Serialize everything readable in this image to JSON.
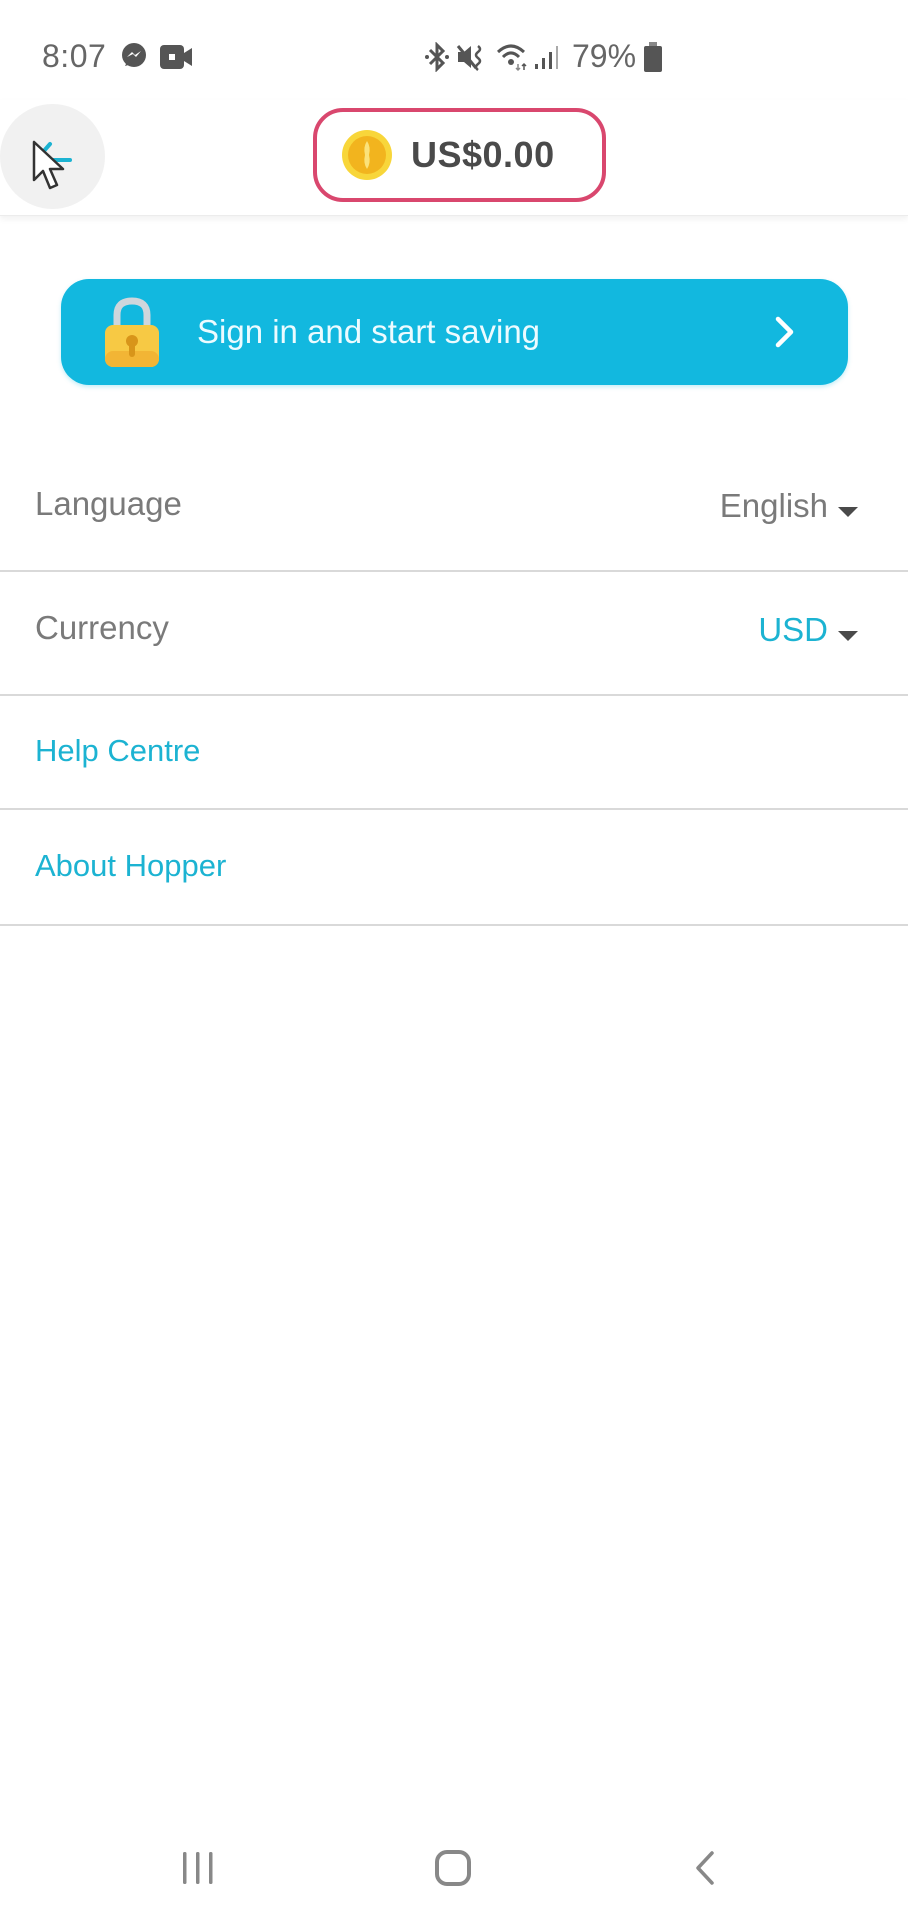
{
  "status_bar": {
    "time": "8:07",
    "left_icons": [
      "messenger-icon",
      "video-camera-icon"
    ],
    "right_icons": [
      "bluetooth-icon",
      "vibrate-mute-icon",
      "wifi-icon",
      "signal-icon",
      "battery-icon"
    ],
    "battery_percent": "79%"
  },
  "header": {
    "back_icon": "arrow-left-icon",
    "balance": "US$0.00",
    "coin_icon": "coin-icon",
    "colors": {
      "pill_border": "#d9476e",
      "accent": "#1cb3d2"
    }
  },
  "signin_banner": {
    "label": "Sign in and start saving",
    "icon": "lock-icon",
    "chevron": "chevron-right-icon",
    "background": "#12b8df"
  },
  "settings": {
    "language": {
      "label": "Language",
      "value": "English"
    },
    "currency": {
      "label": "Currency",
      "value": "USD"
    },
    "links": [
      {
        "label": "Help Centre"
      },
      {
        "label": "About Hopper"
      }
    ]
  },
  "nav_bar": {
    "buttons": [
      "recent-apps",
      "home",
      "back"
    ]
  }
}
